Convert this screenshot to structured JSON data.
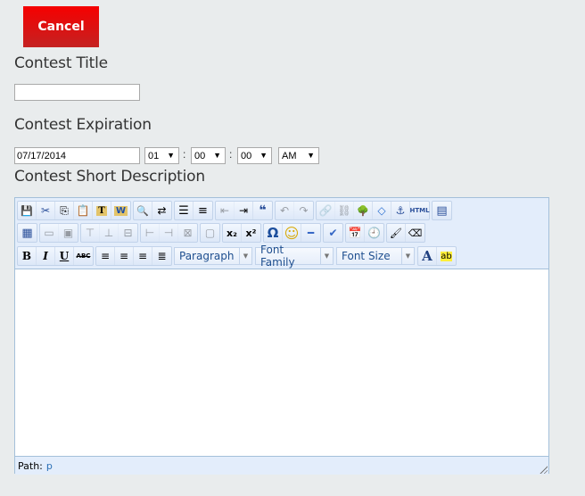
{
  "cancel_label": "Cancel",
  "contest_title": {
    "label": "Contest Title",
    "value": ""
  },
  "contest_expiration": {
    "label": "Contest Expiration",
    "date": "07/17/2014",
    "hour": "01",
    "minute": "00",
    "second": "00",
    "ampm": "AM",
    "separator": ":",
    "arrow": "▼"
  },
  "short_description": {
    "label": "Contest Short Description",
    "toolbar": {
      "row1": [
        [
          {
            "name": "save",
            "glyph": "💾"
          },
          {
            "name": "cut",
            "glyph": "✂"
          },
          {
            "name": "copy",
            "glyph": "⎘"
          },
          {
            "name": "paste",
            "glyph": "📋"
          },
          {
            "name": "paste-text",
            "glyph": "T"
          },
          {
            "name": "paste-word",
            "glyph": "W"
          }
        ],
        [
          {
            "name": "find",
            "glyph": "🔍"
          },
          {
            "name": "replace",
            "glyph": "⇄"
          }
        ],
        [
          {
            "name": "bullet-list",
            "glyph": "☰"
          },
          {
            "name": "numbered-list",
            "glyph": "≡"
          }
        ],
        [
          {
            "name": "outdent",
            "glyph": "⇤",
            "disabled": true
          },
          {
            "name": "indent",
            "glyph": "⇥"
          },
          {
            "name": "blockquote",
            "glyph": "❝"
          }
        ],
        [
          {
            "name": "undo",
            "glyph": "↶",
            "disabled": true
          },
          {
            "name": "redo",
            "glyph": "↷",
            "disabled": true
          }
        ],
        [
          {
            "name": "link",
            "glyph": "🔗",
            "disabled": true
          },
          {
            "name": "unlink",
            "glyph": "⛓",
            "disabled": true
          },
          {
            "name": "image",
            "glyph": "🌳"
          },
          {
            "name": "code",
            "glyph": "◇"
          },
          {
            "name": "anchor",
            "glyph": "⚓"
          },
          {
            "name": "html",
            "glyph": "HTML"
          }
        ],
        [
          {
            "name": "fullscreen",
            "glyph": "▤"
          }
        ]
      ],
      "row2": [
        [
          {
            "name": "table",
            "glyph": "▦"
          }
        ],
        [
          {
            "name": "row-props",
            "glyph": "▭",
            "disabled": true
          },
          {
            "name": "cell-props",
            "glyph": "▣",
            "disabled": true
          }
        ],
        [
          {
            "name": "insert-row-before",
            "glyph": "⊤",
            "disabled": true
          },
          {
            "name": "insert-row-after",
            "glyph": "⊥",
            "disabled": true
          },
          {
            "name": "delete-row",
            "glyph": "⊟",
            "disabled": true
          }
        ],
        [
          {
            "name": "insert-col-before",
            "glyph": "⊢",
            "disabled": true
          },
          {
            "name": "insert-col-after",
            "glyph": "⊣",
            "disabled": true
          },
          {
            "name": "delete-col",
            "glyph": "⊠",
            "disabled": true
          }
        ],
        [
          {
            "name": "merge-cells",
            "glyph": "▢",
            "disabled": true
          }
        ],
        [
          {
            "name": "subscript",
            "glyph": "x₂"
          },
          {
            "name": "superscript",
            "glyph": "x²"
          }
        ],
        [
          {
            "name": "special-char",
            "glyph": "Ω"
          },
          {
            "name": "emoticon",
            "glyph": "☺"
          },
          {
            "name": "horizontal-rule",
            "glyph": "━"
          }
        ],
        [
          {
            "name": "spellcheck",
            "glyph": "✔"
          }
        ],
        [
          {
            "name": "insert-date",
            "glyph": "📅"
          },
          {
            "name": "insert-time",
            "glyph": "🕘"
          }
        ],
        [
          {
            "name": "cleanup",
            "glyph": "🖌"
          },
          {
            "name": "remove-format",
            "glyph": "⌫"
          }
        ]
      ],
      "row3_format": [
        [
          {
            "name": "bold",
            "glyph": "B"
          },
          {
            "name": "italic",
            "glyph": "I"
          },
          {
            "name": "underline",
            "glyph": "U"
          },
          {
            "name": "strikethrough",
            "glyph": "ABC"
          }
        ],
        [
          {
            "name": "align-left",
            "glyph": "≡"
          },
          {
            "name": "align-center",
            "glyph": "≡"
          },
          {
            "name": "align-right",
            "glyph": "≡"
          },
          {
            "name": "align-justify",
            "glyph": "≣"
          }
        ]
      ],
      "dropdowns": {
        "format": "Paragraph",
        "font_family": "Font Family",
        "font_size": "Font Size",
        "arrow": "▼"
      },
      "row3_color": [
        {
          "name": "text-color",
          "glyph": "A"
        },
        {
          "name": "highlight-color",
          "glyph": "ab"
        }
      ]
    },
    "content": "",
    "status": {
      "path_label": "Path:",
      "path_value": "p"
    }
  }
}
